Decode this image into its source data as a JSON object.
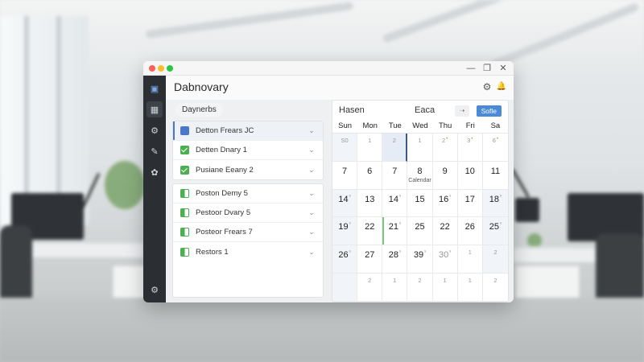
{
  "window": {
    "title": "Dabnovary",
    "traffic": {
      "close": "#ff5f57",
      "min": "#febc2e",
      "max": "#28c840"
    },
    "controls": {
      "minimize": "—",
      "restore": "❐",
      "close": "✕"
    }
  },
  "sidebar": {
    "items": [
      {
        "name": "logo-icon",
        "glyph": "▣"
      },
      {
        "name": "dashboard-icon",
        "glyph": "▦",
        "active": true
      },
      {
        "name": "settings-icon",
        "glyph": "⚙"
      },
      {
        "name": "edit-icon",
        "glyph": "✎"
      },
      {
        "name": "cog-icon",
        "glyph": "✿"
      }
    ],
    "bottom_glyph": "⚙"
  },
  "header": {
    "icons": [
      {
        "name": "settings-icon",
        "glyph": "⚙"
      },
      {
        "name": "bell-icon",
        "glyph": "🔔"
      }
    ]
  },
  "list": {
    "filter_label": "Daynerbs",
    "group1": [
      {
        "label": "Detton Frears JC",
        "icon": "cal",
        "selected": true
      },
      {
        "label": "Detten Dnary 1",
        "icon": "check"
      },
      {
        "label": "Pusiane Eeany 2",
        "icon": "check"
      }
    ],
    "group2": [
      {
        "label": "Poston Demy 5",
        "icon": "half"
      },
      {
        "label": "Pestoor Dvary 5",
        "icon": "half"
      },
      {
        "label": "Posteor Frears 7",
        "icon": "half"
      },
      {
        "label": "Restors 1",
        "icon": "half"
      }
    ],
    "chevron": "⌄"
  },
  "calendar": {
    "title": "Hasen",
    "subtitle": "Eaca",
    "nav_glyph": "➝",
    "action_label": "Sofle",
    "days": [
      "Sun",
      "Mon",
      "Tue",
      "Wed",
      "Thu",
      "Fri",
      "Sa"
    ],
    "cells": [
      {
        "n": "S0",
        "small": true,
        "shade": true
      },
      {
        "n": "1",
        "small": true
      },
      {
        "n": "2",
        "small": true,
        "hl": true,
        "sel": true
      },
      {
        "n": "1",
        "small": true
      },
      {
        "n": "2",
        "small": true,
        "mark": "•",
        "markColor": "orange"
      },
      {
        "n": "3",
        "small": true,
        "mark": "•",
        "markColor": "orange"
      },
      {
        "n": "6",
        "small": true,
        "mark": "•",
        "markColor": "orange"
      },
      {
        "n": "7"
      },
      {
        "n": "6"
      },
      {
        "n": "7"
      },
      {
        "n": "8",
        "note": "Calendar"
      },
      {
        "n": "9"
      },
      {
        "n": "10"
      },
      {
        "n": "11"
      },
      {
        "n": "14",
        "mark": "ˢ",
        "shade": true
      },
      {
        "n": "13"
      },
      {
        "n": "14",
        "mark": "ˢ"
      },
      {
        "n": "15"
      },
      {
        "n": "16",
        "mark": "ˢ"
      },
      {
        "n": "17"
      },
      {
        "n": "18",
        "mark": "ˢ",
        "shade": true
      },
      {
        "n": "19",
        "mark": "ˢ",
        "shade": true
      },
      {
        "n": "22"
      },
      {
        "n": "21",
        "mark": "ˢ",
        "green": true
      },
      {
        "n": "25"
      },
      {
        "n": "22"
      },
      {
        "n": "26"
      },
      {
        "n": "25",
        "mark": "ˢ",
        "shade": true
      },
      {
        "n": "26",
        "mark": "ˢ",
        "shade": true
      },
      {
        "n": "27"
      },
      {
        "n": "28",
        "mark": "ˢ"
      },
      {
        "n": "39",
        "mark": "ˢ"
      },
      {
        "n": "30",
        "mark": "ˢ",
        "muted": true
      },
      {
        "n": "1",
        "small": true
      },
      {
        "n": "2",
        "small": true,
        "shade": true
      },
      {
        "n": "",
        "shade": true
      },
      {
        "n": "2",
        "small": true
      },
      {
        "n": "1",
        "small": true
      },
      {
        "n": "2",
        "small": true
      },
      {
        "n": "1",
        "small": true
      },
      {
        "n": "1",
        "small": true
      },
      {
        "n": "2",
        "small": true
      }
    ]
  }
}
